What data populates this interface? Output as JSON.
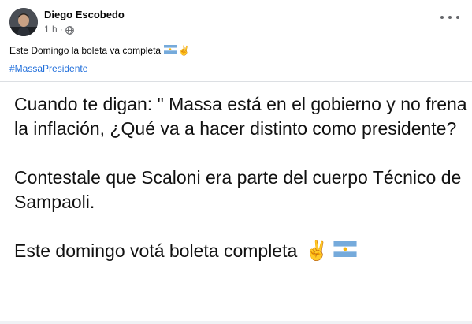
{
  "post": {
    "author": "Diego Escobedo",
    "time": "1 h",
    "separator": "·",
    "caption": "Este Domingo la boleta va completa",
    "hashtag": "#MassaPresidente",
    "body": {
      "paragraph1": "Cuando te digan: \" Massa está en el gobierno y no frena la inflación, ¿Qué va a hacer distinto como presidente?",
      "paragraph2": "Contestale que Scaloni era parte del cuerpo Técnico de Sampaoli.",
      "paragraph3": "Este domingo votá boleta completa"
    },
    "emoji": {
      "peace": "✌️"
    },
    "icons": {
      "privacy": "globe-icon",
      "more": "more-options-icon",
      "flag": "argentina-flag-icon"
    }
  },
  "colors": {
    "hashtag": "#216fdb",
    "meta_text": "#65676b",
    "flag_blue": "#75aadb",
    "flag_sun": "#f6b40e"
  }
}
